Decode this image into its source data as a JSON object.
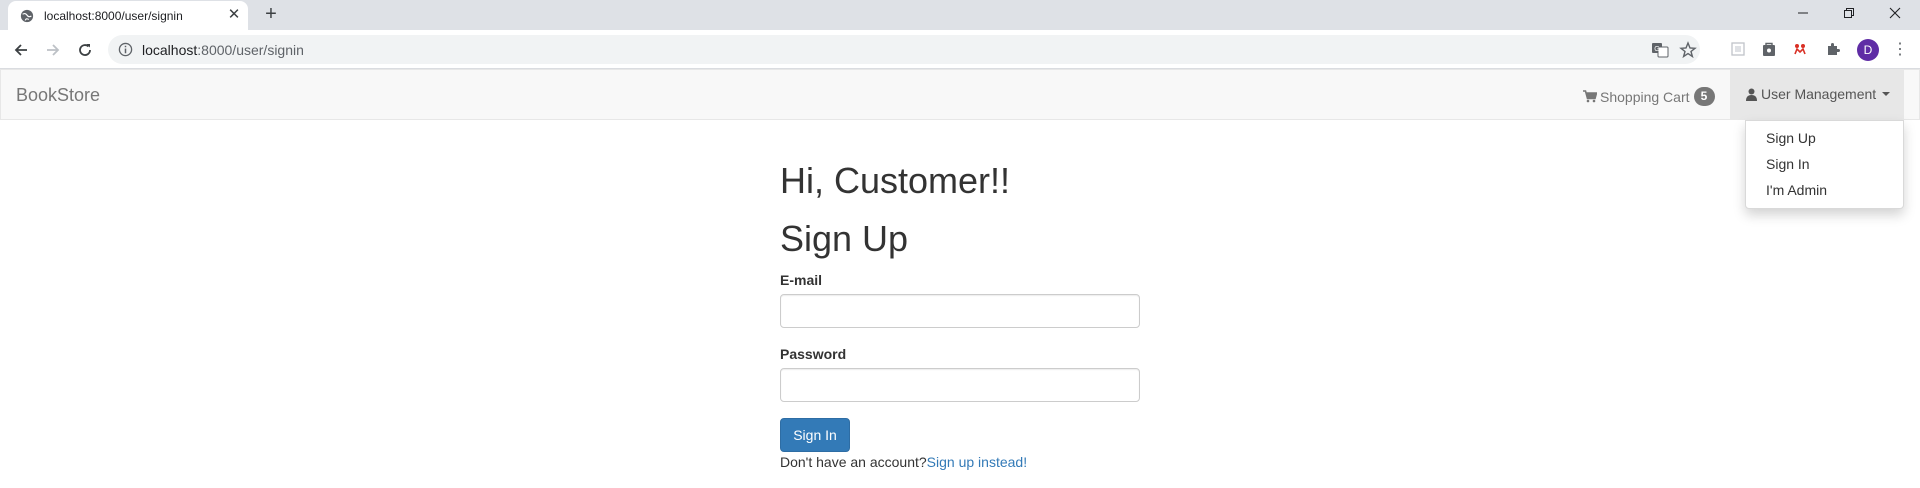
{
  "browser": {
    "tab_title": "localhost:8000/user/signin",
    "url_host": "localhost",
    "url_path": ":8000/user/signin",
    "avatar_initial": "D"
  },
  "navbar": {
    "brand": "BookStore",
    "cart_label": "Shopping Cart",
    "cart_count": "5",
    "user_menu_label": "User Management"
  },
  "dropdown": {
    "items": [
      "Sign Up",
      "Sign In",
      "I'm Admin"
    ]
  },
  "page": {
    "greeting": "Hi, Customer!!",
    "heading": "Sign Up",
    "email_label": "E-mail",
    "email_value": "",
    "password_label": "Password",
    "password_value": "",
    "submit_label": "Sign In",
    "no_account_text": "Don't have an account?",
    "signup_link": "Sign up instead!"
  },
  "colors": {
    "primary": "#337ab7",
    "navbar_bg": "#f8f8f8",
    "badge_bg": "#777777"
  }
}
